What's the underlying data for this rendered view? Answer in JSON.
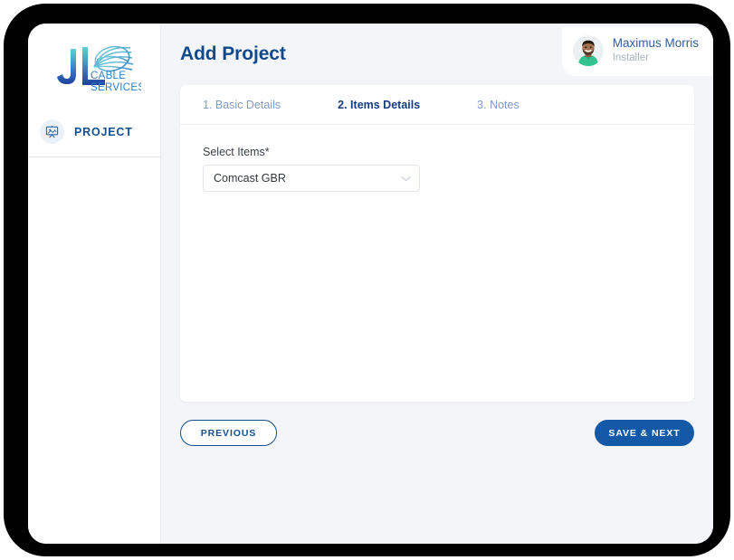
{
  "sidebar": {
    "logo": {
      "initials": "JL",
      "line1": "CABLE",
      "line2": "SERVICES"
    },
    "items": [
      {
        "label": "PROJECT",
        "icon": "presentation-board-icon"
      }
    ]
  },
  "header": {
    "title": "Add Project",
    "user": {
      "name": "Maximus Morris",
      "role": "Installer",
      "avatar_icon": "user-avatar-photo"
    }
  },
  "card": {
    "tabs": [
      {
        "label": "1. Basic Details",
        "active": false
      },
      {
        "label": "2. Items Details",
        "active": true
      },
      {
        "label": "3. Notes",
        "active": false
      }
    ],
    "fields": {
      "select_items": {
        "label": "Select Items*",
        "value": "Comcast GBR",
        "chevron_icon": "chevron-down-icon"
      }
    }
  },
  "footer": {
    "previous_label": "PREVIOUS",
    "save_next_label": "SAVE & NEXT"
  },
  "colors": {
    "brand_blue": "#14508f",
    "primary_button": "#1459a8",
    "page_background": "#f4f5f9",
    "muted_tab": "#7e9ac4"
  }
}
